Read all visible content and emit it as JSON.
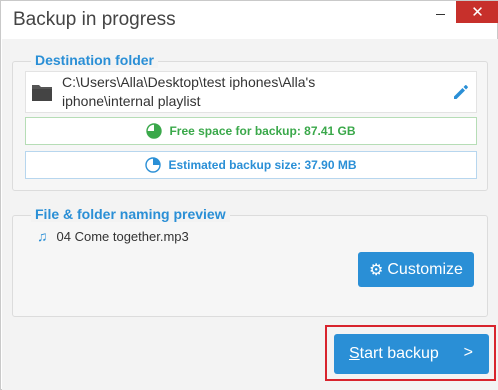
{
  "window": {
    "title": "Backup in progress",
    "minimize_icon": "minimize-icon",
    "close_icon": "close-icon",
    "close_color": "#c7302b"
  },
  "destination": {
    "heading": "Destination folder",
    "path_line1": "C:\\Users\\Alla\\Desktop\\test iphones\\Alla's",
    "path_line2": "iphone\\internal playlist",
    "free_space": "Free space for backup: 87.41 GB",
    "estimated_size": "Estimated backup size: 37.90 MB"
  },
  "naming": {
    "heading": "File & folder naming preview",
    "file": "04 Come together.mp3",
    "customize_label": "Customize"
  },
  "actions": {
    "start_prefix": "S",
    "start_rest": "tart backup",
    "start_arrow": ">"
  },
  "colors": {
    "accent": "#2a8fd6",
    "green": "#3aa84a",
    "highlight": "#d8242d"
  }
}
